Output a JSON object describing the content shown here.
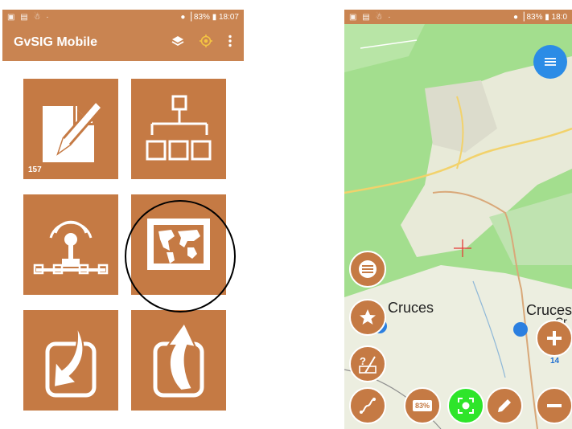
{
  "status_bar": {
    "left_icons": "▣ ▤ ☃ ·",
    "right_text": "●▕ 83% ▮ 18:07",
    "right_text_cut": "●▕ 83% ▮ 18:0"
  },
  "app": {
    "title": "GvSIG Mobile"
  },
  "tiles": {
    "notes_badge": "157"
  },
  "map": {
    "label_left": "Cruces",
    "label_right": "Cruces",
    "label_right_sub": "Cr",
    "zoom_level": "14",
    "battery_label": "83%"
  },
  "colors": {
    "brand": "#c57a44",
    "appbar": "#c98451",
    "map_green": "#a3de8e",
    "gps_fab": "#2ee52a",
    "menu_fab": "#2b8ce6"
  }
}
